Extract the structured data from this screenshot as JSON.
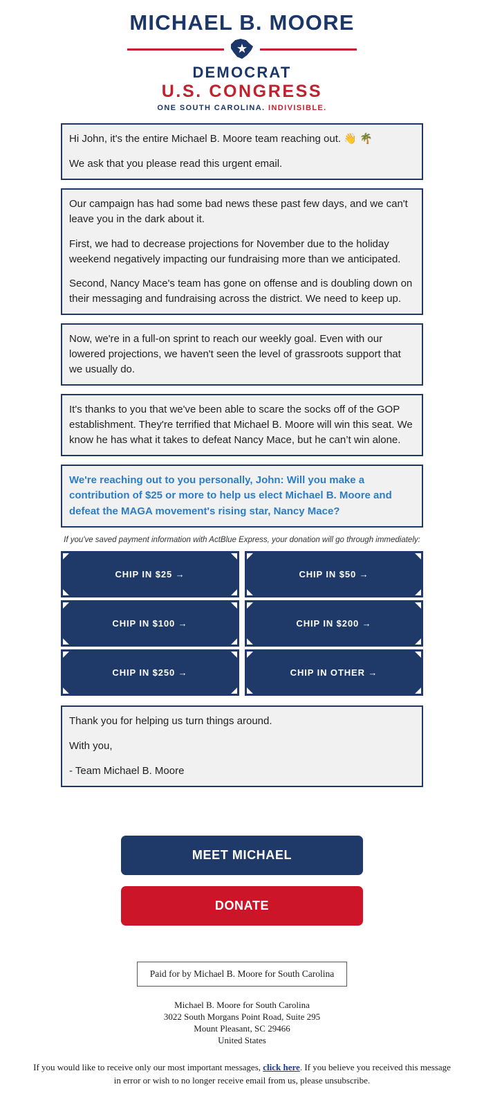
{
  "logo": {
    "candidate_name": "MICHAEL B. MOORE",
    "party": "DEMOCRAT",
    "office": "U.S. CONGRESS",
    "tagline_primary": "ONE SOUTH CAROLINA.",
    "tagline_accent": "INDIVISIBLE.",
    "state_icon": "south-carolina-state-icon",
    "navy": "#1b3668",
    "red": "#c2202f"
  },
  "blocks": [
    {
      "id": "greeting-block",
      "style": "plain",
      "paragraphs": [
        "Hi John, it's the entire Michael B. Moore team reaching out. 👋 🌴",
        "We ask that you please read this urgent email."
      ]
    },
    {
      "id": "bad-news-block",
      "style": "plain",
      "paragraphs": [
        "Our campaign has had some bad news these past few days, and we can't leave you in the dark about it.",
        "First, we had to decrease projections for November due to the holiday weekend negatively impacting our fundraising more than we anticipated.",
        "Second, Nancy Mace's team has gone on offense and is doubling down on their messaging and fundraising across the district. We need to keep up."
      ]
    },
    {
      "id": "sprint-block",
      "style": "plain",
      "paragraphs": [
        "Now, we're in a full-on sprint to reach our weekly goal. Even with our lowered projections, we haven't seen the level of grassroots support that we usually do."
      ]
    },
    {
      "id": "gop-block",
      "style": "plain",
      "paragraphs": [
        "It's thanks to you that we've been able to scare the socks off of the GOP establishment. They're terrified that Michael B. Moore will win this seat. We know he has what it takes to defeat Nancy Mace, but he can’t win alone."
      ]
    },
    {
      "id": "ask-block",
      "style": "highlight",
      "paragraphs": [
        "We're reaching out to you personally, John: Will you make a contribution of $25 or more to help us elect Michael B. Moore and defeat the MAGA movement's rising star, Nancy Mace?"
      ]
    }
  ],
  "actblue_note": "If you've saved payment information with ActBlue Express, your donation will go through immediately:",
  "chip_buttons": [
    {
      "label": "CHIP IN $25 →",
      "amount": "25"
    },
    {
      "label": "CHIP IN $50 →",
      "amount": "50"
    },
    {
      "label": "CHIP IN $100 →",
      "amount": "100"
    },
    {
      "label": "CHIP IN $200 →",
      "amount": "200"
    },
    {
      "label": "CHIP IN $250 →",
      "amount": "250"
    },
    {
      "label": "CHIP IN OTHER →",
      "amount": "other"
    }
  ],
  "signoff_block": {
    "id": "signoff-block",
    "paragraphs": [
      "Thank you for helping us turn things around.",
      "With you,",
      "- Team Michael B. Moore"
    ]
  },
  "cta": {
    "meet_label": "MEET MICHAEL",
    "donate_label": "DONATE",
    "meet_color": "#1f3a68",
    "donate_color": "#cc1528"
  },
  "footer": {
    "paid_for": "Paid for by Michael B. Moore for South Carolina",
    "address_lines": [
      "Michael B. Moore for South Carolina",
      "3022 South Morgans Point Road, Suite 295",
      "Mount Pleasant, SC 29466",
      "United States"
    ],
    "unsub_pre": "If you would like to receive only our most important messages, ",
    "unsub_link": "click here",
    "unsub_post": ". If you believe you received this message in error or wish to no longer receive email from us, please unsubscribe."
  }
}
